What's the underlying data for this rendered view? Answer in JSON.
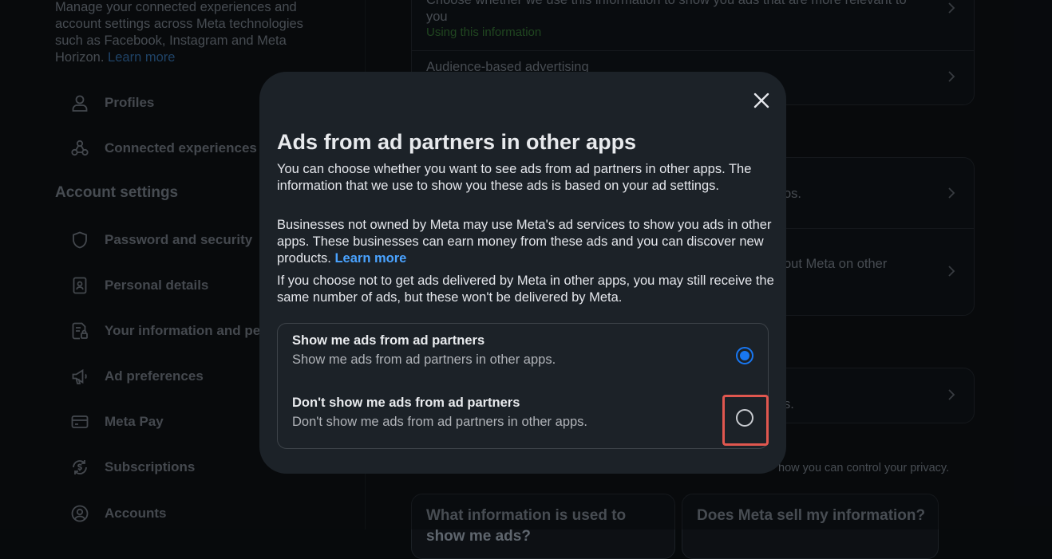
{
  "sidebar": {
    "intro_text": "Manage your connected experiences and account settings across Meta technologies such as Facebook, Instagram and Meta Horizon.",
    "learn_more": "Learn more",
    "items_top": [
      {
        "label": "Profiles",
        "icon": "person-icon"
      },
      {
        "label": "Connected experiences",
        "icon": "connected-icon"
      }
    ],
    "account_settings_title": "Account settings",
    "items": [
      {
        "label": "Password and security",
        "icon": "shield-icon"
      },
      {
        "label": "Personal details",
        "icon": "id-card-icon"
      },
      {
        "label": "Your information and pe",
        "icon": "document-lock-icon"
      },
      {
        "label": "Ad preferences",
        "icon": "megaphone-icon"
      },
      {
        "label": "Meta Pay",
        "icon": "card-icon"
      },
      {
        "label": "Subscriptions",
        "icon": "dollar-cycle-icon"
      },
      {
        "label": "Accounts",
        "icon": "account-circle-icon"
      }
    ]
  },
  "background": {
    "row1_text": "Choose whether we use this information to show you ads that are more relevant to you",
    "row1_status": "Using this information",
    "row2_text": "Audience-based advertising",
    "row3_text": "os.",
    "row4_text": "out Meta on other",
    "row5_text": "s.",
    "privacy_text": "how you can control your privacy.",
    "card_left": "What information is used to show me ads?",
    "card_right": "Does Meta sell my information?"
  },
  "modal": {
    "title": "Ads from ad partners in other apps",
    "p1": "You can choose whether you want to see ads from ad partners in other apps. The information that we use to show you these ads is based on your ad settings.",
    "p2": "Businesses not owned by Meta may use Meta's ad services to show you ads in other apps. These businesses can earn money from these ads and you can discover new products.",
    "p2_link": "Learn more",
    "p3": "If you choose not to get ads delivered by Meta in other apps, you may still receive the same number of ads, but these won't be delivered by Meta.",
    "options": [
      {
        "title": "Show me ads from ad partners",
        "desc": "Show me ads from ad partners in other apps.",
        "selected": true
      },
      {
        "title": "Don't show me ads from ad partners",
        "desc": "Don't show me ads from ad partners in other apps.",
        "selected": false
      }
    ]
  },
  "colors": {
    "accent": "#1877f2",
    "link": "#4aa3ff",
    "highlight": "#e0574f",
    "modal_bg": "#1c2228"
  }
}
